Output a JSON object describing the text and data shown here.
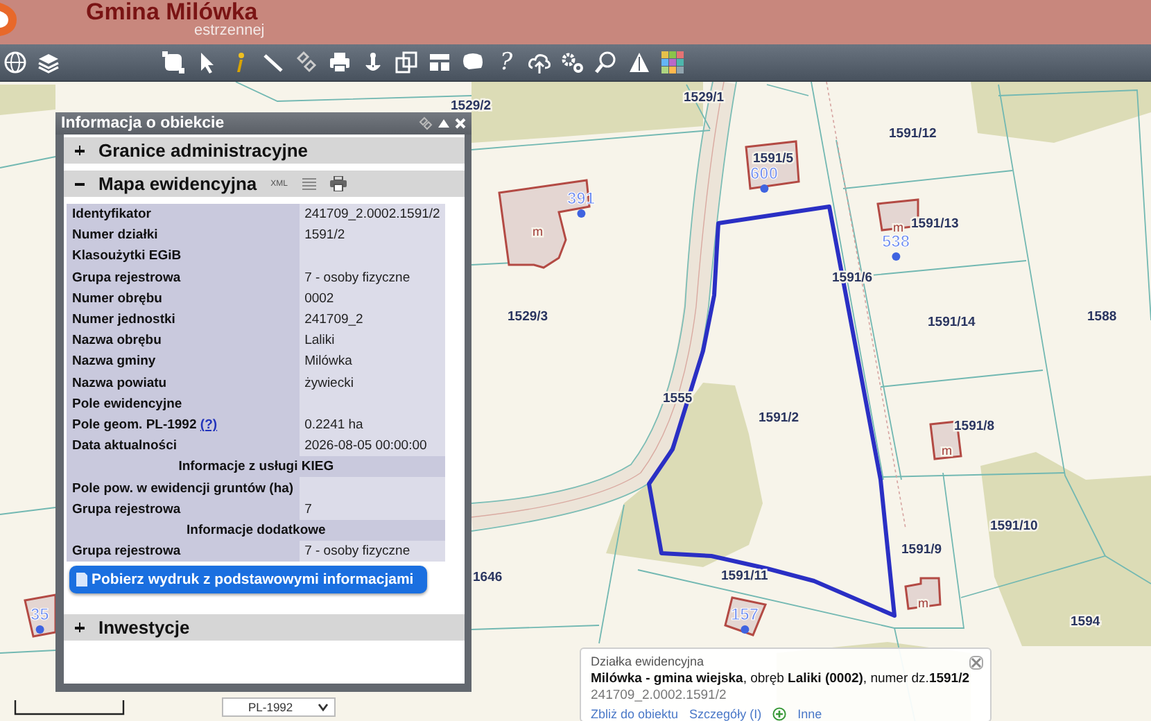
{
  "header": {
    "title": "Gmina Milówka",
    "subtitle": "estrzennej"
  },
  "toolbar": {
    "help_label": "?"
  },
  "map": {
    "labels": [
      {
        "kind": "parcel",
        "text": "1529/2"
      },
      {
        "kind": "parcel",
        "text": "1529/1"
      },
      {
        "kind": "parcel",
        "text": "1591/12"
      },
      {
        "kind": "parcel",
        "text": "1591/5"
      },
      {
        "kind": "address",
        "text": "600"
      },
      {
        "kind": "address",
        "text": "391"
      },
      {
        "kind": "building",
        "text": "m"
      },
      {
        "kind": "parcel",
        "text": "1591/13"
      },
      {
        "kind": "building",
        "text": "m"
      },
      {
        "kind": "address",
        "text": "538"
      },
      {
        "kind": "parcel",
        "text": "1591/6"
      },
      {
        "kind": "parcel",
        "text": "1529/3"
      },
      {
        "kind": "parcel",
        "text": "1591/14"
      },
      {
        "kind": "parcel",
        "text": "1588"
      },
      {
        "kind": "parcel",
        "text": "1555"
      },
      {
        "kind": "parcel",
        "text": "1591/2"
      },
      {
        "kind": "parcel",
        "text": "1591/8"
      },
      {
        "kind": "building",
        "text": "m"
      },
      {
        "kind": "parcel",
        "text": "1591/10"
      },
      {
        "kind": "parcel",
        "text": "1591/9"
      },
      {
        "kind": "parcel",
        "text": "1646"
      },
      {
        "kind": "parcel",
        "text": "1591/11"
      },
      {
        "kind": "building",
        "text": "m"
      },
      {
        "kind": "address",
        "text": "35"
      },
      {
        "kind": "address",
        "text": "157"
      },
      {
        "kind": "parcel",
        "text": "1594"
      }
    ]
  },
  "info_panel": {
    "title": "Informacja o obiekcie",
    "sections": [
      {
        "title": "Granice administracyjne",
        "expanded": false
      },
      {
        "title": "Mapa ewidencyjna",
        "expanded": true,
        "export_label": "XML",
        "rows": [
          {
            "kind": "field",
            "label": "Identyfikator",
            "value": "241709_2.0002.1591/2"
          },
          {
            "kind": "field",
            "label": "Numer działki",
            "value": "1591/2"
          },
          {
            "kind": "field",
            "label": "Klasoużytki EGiB"
          },
          {
            "kind": "field",
            "label": "Grupa rejestrowa",
            "value": "7 - osoby fizyczne"
          },
          {
            "kind": "field",
            "label": "Numer obrębu",
            "value": "0002"
          },
          {
            "kind": "field",
            "label": "Numer jednostki",
            "value": "241709_2"
          },
          {
            "kind": "field",
            "label": "Nazwa obrębu",
            "value": "Laliki"
          },
          {
            "kind": "field",
            "label": "Nazwa gminy",
            "value": "Milówka"
          },
          {
            "kind": "field",
            "label": "Nazwa powiatu",
            "value": "żywiecki"
          },
          {
            "kind": "field",
            "label": "Pole ewidencyjne"
          },
          {
            "kind": "field",
            "label": "Pole geom. PL-1992",
            "link": "(?)",
            "value": "0.2241 ha"
          },
          {
            "kind": "field",
            "label": "Data aktualności",
            "value": "2026-08-05 00:00:00"
          },
          {
            "kind": "heading",
            "label": "Informacje z usługi KIEG"
          },
          {
            "kind": "field",
            "label": "Pole pow. w ewidencji gruntów (ha)"
          },
          {
            "kind": "field",
            "label": "Grupa rejestrowa",
            "value": "7"
          },
          {
            "kind": "heading",
            "label": "Informacje dodatkowe"
          },
          {
            "kind": "field",
            "label": "Grupa rejestrowa",
            "value": "7 - osoby fizyczne"
          }
        ],
        "button": "Pobierz wydruk z podstawowymi informacjami"
      },
      {
        "title": "Inwestycje",
        "expanded": false
      }
    ]
  },
  "popup": {
    "title": "Działka ewidencyjna",
    "summary": "**Milówka - gmina wiejska**, obręb **Laliki (0002)**, numer dz.**1591/2**",
    "id": "241709_2.0002.1591/2",
    "actions": [
      {
        "kind": "link",
        "label": "Zbliż do obiektu"
      },
      {
        "kind": "link",
        "label": "Szczegóły (I)"
      },
      {
        "kind": "add"
      },
      {
        "kind": "link",
        "label": "Inne"
      }
    ]
  },
  "projection_select": {
    "value": "PL-1992"
  }
}
